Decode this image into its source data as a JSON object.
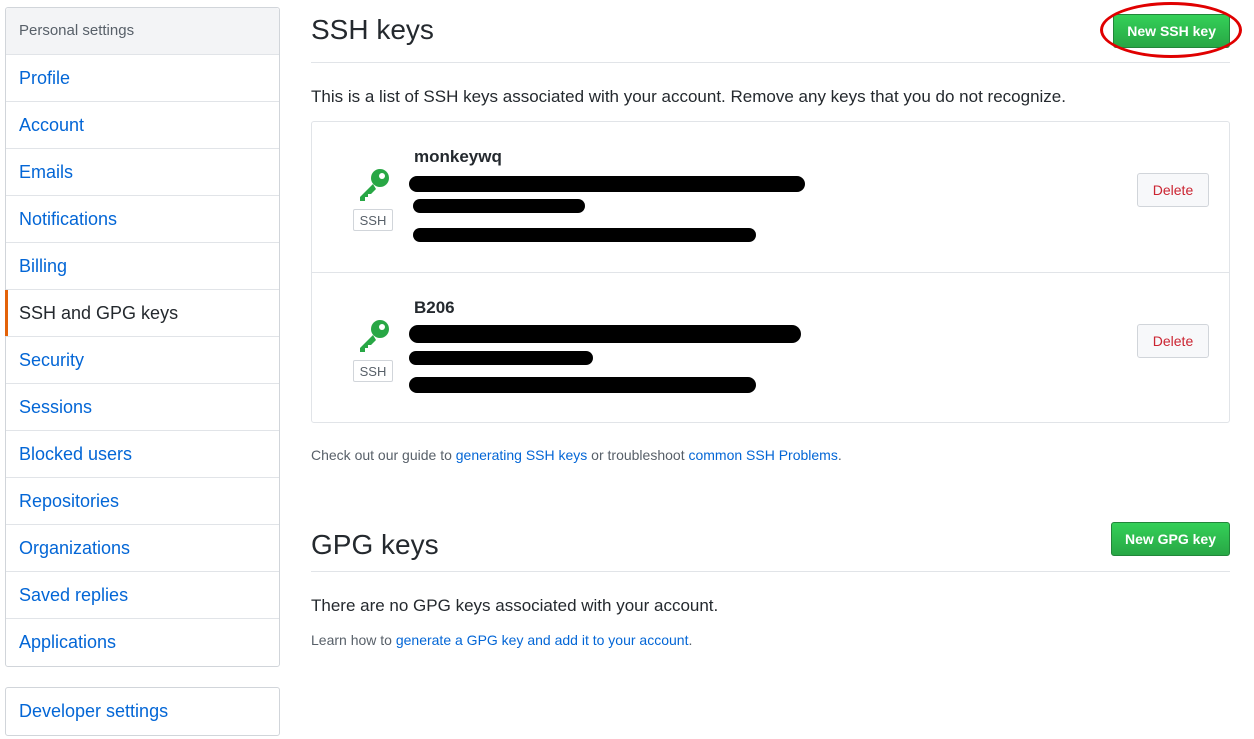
{
  "sidebar": {
    "heading": "Personal settings",
    "items": [
      {
        "label": "Profile"
      },
      {
        "label": "Account"
      },
      {
        "label": "Emails"
      },
      {
        "label": "Notifications"
      },
      {
        "label": "Billing"
      },
      {
        "label": "SSH and GPG keys",
        "selected": true
      },
      {
        "label": "Security"
      },
      {
        "label": "Sessions"
      },
      {
        "label": "Blocked users"
      },
      {
        "label": "Repositories"
      },
      {
        "label": "Organizations"
      },
      {
        "label": "Saved replies"
      },
      {
        "label": "Applications"
      }
    ],
    "developer": "Developer settings",
    "selected_accent": "#e36209"
  },
  "ssh": {
    "title": "SSH keys",
    "new_button": "New SSH key",
    "intro": "This is a list of SSH keys associated with your account. Remove any keys that you do not recognize.",
    "keys": [
      {
        "title": "monkeywq",
        "badge": "SSH",
        "delete_label": "Delete",
        "icon": "key-icon",
        "icon_color": "#28a745"
      },
      {
        "title": "B206",
        "badge": "SSH",
        "delete_label": "Delete",
        "icon": "key-icon",
        "icon_color": "#28a745"
      }
    ],
    "help": {
      "prefix": "Check out our guide to ",
      "link1": "generating SSH keys",
      "middle": " or troubleshoot ",
      "link2": "common SSH Problems",
      "suffix": "."
    }
  },
  "gpg": {
    "title": "GPG keys",
    "new_button": "New GPG key",
    "empty": "There are no GPG keys associated with your account.",
    "help": {
      "prefix": "Learn how to ",
      "link": "generate a GPG key and add it to your account",
      "suffix": "."
    }
  },
  "colors": {
    "primary": "#28a745",
    "link": "#0366d6",
    "danger": "#cb2431",
    "annotation": "#e00000"
  }
}
